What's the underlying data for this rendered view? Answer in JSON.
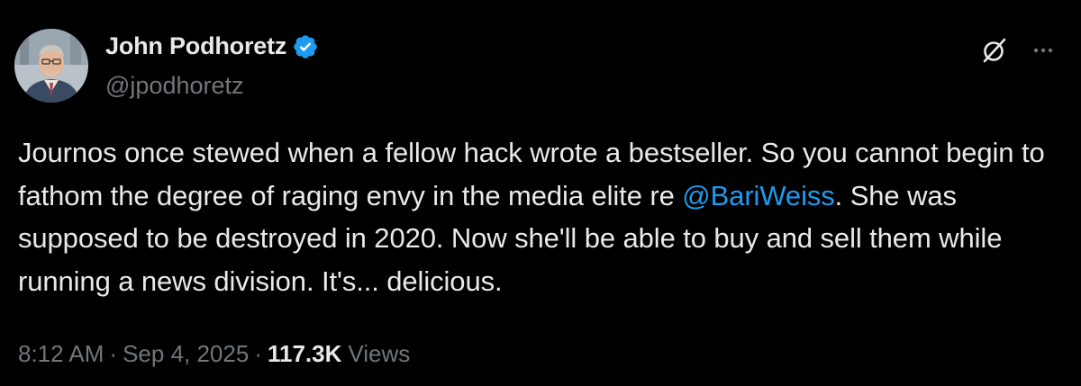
{
  "author": {
    "display_name": "John Podhoretz",
    "handle": "@jpodhoretz",
    "verified": true
  },
  "tweet": {
    "text_part1": "Journos once stewed when a fellow hack wrote a bestseller. So you cannot begin to fathom the degree of raging envy in the media elite re ",
    "mention": "@BariWeiss",
    "text_part2": ". She was supposed to be destroyed in 2020. Now she'll be able to buy and sell them while running a news division. It's... delicious."
  },
  "meta": {
    "time": "8:12 AM",
    "separator": "·",
    "date": "Sep 4, 2025",
    "views_count": "117.3K",
    "views_label": "Views"
  },
  "icons": {
    "verified": "verified-badge-icon",
    "grok": "grok-icon",
    "more": "more-options-icon"
  },
  "colors": {
    "background": "#000000",
    "text": "#e7e9ea",
    "secondary": "#71767b",
    "accent": "#1d9bf0"
  }
}
